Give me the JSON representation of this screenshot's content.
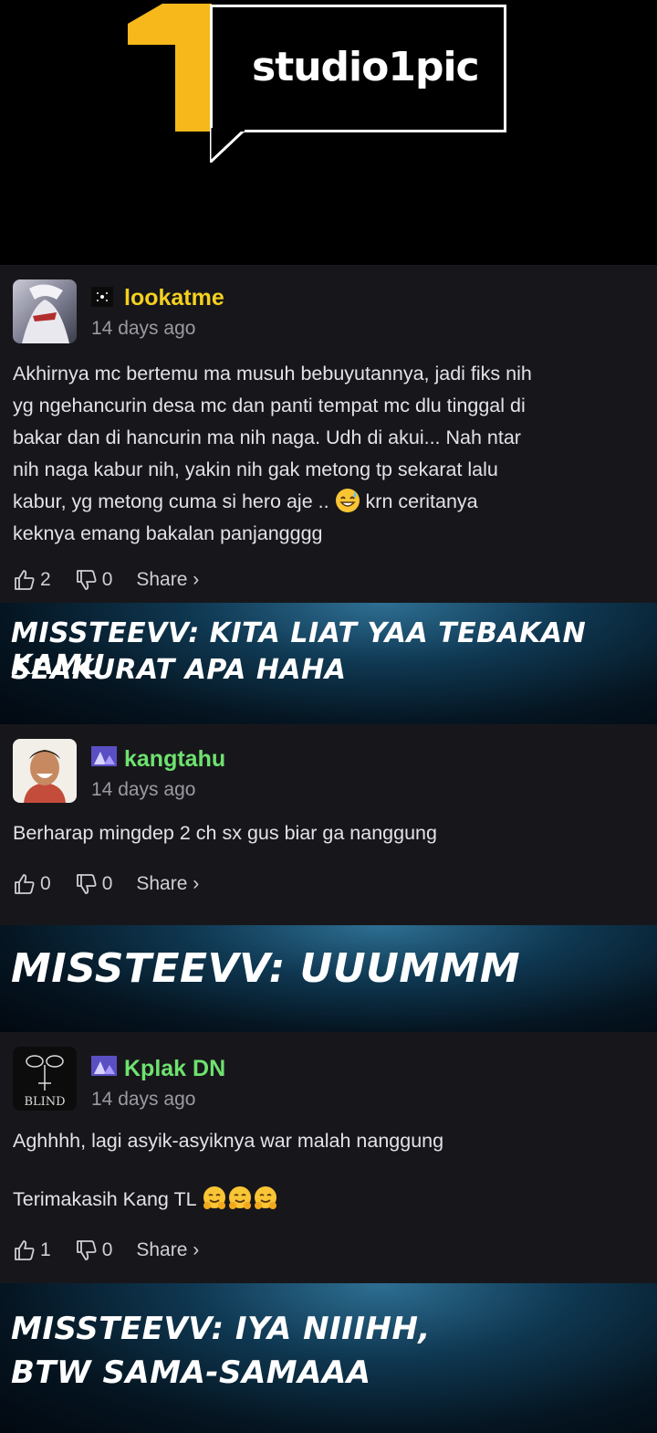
{
  "header": {
    "logo_text": "studio1pic"
  },
  "comments": [
    {
      "username": "lookatme",
      "username_color": "#f5d020",
      "time": "14 days ago",
      "text_lines": [
        "Akhirnya mc bertemu ma musuh bebuyutannya, jadi fiks nih",
        "yg ngehancurin desa mc dan panti tempat mc dlu tinggal di",
        "bakar dan di hancurin ma nih naga. Udh di akui... Nah ntar",
        "nih naga kabur nih, yakin nih gak metong tp sekarat lalu",
        "kabur, yg metong cuma si hero aje .."
      ],
      "text_line5_after": "krn ceritanya",
      "text_line6": "keknya emang bakalan panjangggg",
      "likes": "2",
      "dislikes": "0",
      "share": "Share ›"
    },
    {
      "username": "kangtahu",
      "username_color": "#6ee26e",
      "time": "14 days ago",
      "text": "Berharap mingdep 2 ch sx gus biar ga nanggung",
      "likes": "0",
      "dislikes": "0",
      "share": "Share ›"
    },
    {
      "username": "Kplak DN",
      "username_color": "#6ee26e",
      "time": "14 days ago",
      "text_line1": "Aghhhh, lagi asyik-asyiknya war malah nanggung",
      "text_line2": "Terimakasih Kang TL",
      "avatar_text": "BLIND",
      "likes": "1",
      "dislikes": "0",
      "share": "Share ›"
    }
  ],
  "banners": [
    {
      "line1": "MISSTEEVV: KITA LIAT YAA TEBAKAN KAMU",
      "line2": "SEAKURAT APA HAHA"
    },
    {
      "line1": "MISSTEEVV: UUUMMM"
    },
    {
      "line1": "MISSTEEVV: IYA NIIIHH,",
      "line2": "BTW SAMA-SAMAAA"
    }
  ]
}
